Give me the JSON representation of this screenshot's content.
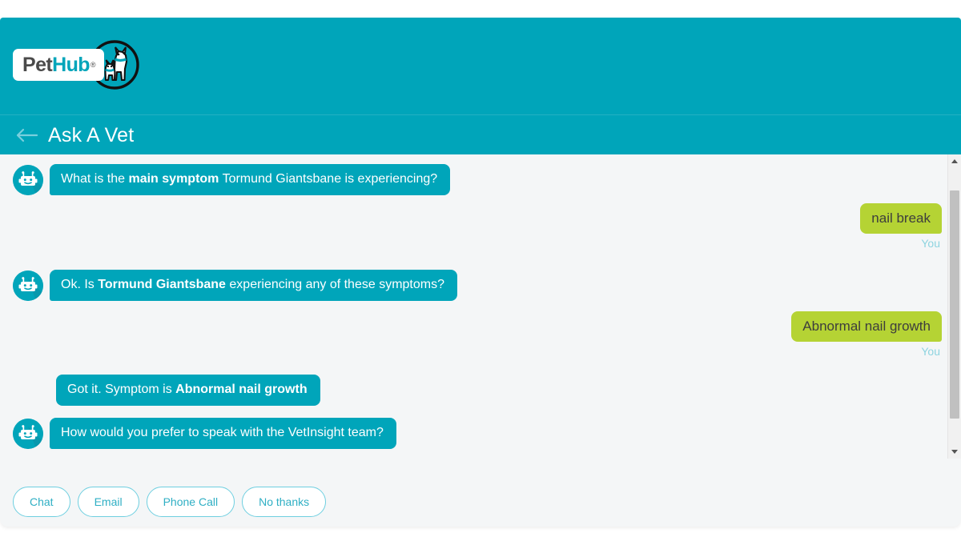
{
  "app": {
    "background_color": "#f4f6f7",
    "accent_color": "#00a5ba",
    "user_bubble_color": "#b5d334"
  },
  "header": {
    "brand": {
      "name_part1": "Pet",
      "name_part2": "Hub",
      "registered_mark": "®",
      "logo_icon": "dog-cat-circle-logo"
    },
    "back_icon": "back-arrow-icon",
    "title": "Ask A Vet"
  },
  "conversation": {
    "messages": [
      {
        "id": "m1",
        "sender": "bot",
        "avatar_icon": "robot-avatar-icon",
        "show_avatar": true,
        "text_before": "What is the ",
        "text_bold": "main symptom",
        "text_after": " Tormund Giantsbane is experiencing?"
      },
      {
        "id": "m2",
        "sender": "user",
        "text": "nail break",
        "label": "You"
      },
      {
        "id": "m3",
        "sender": "bot",
        "avatar_icon": "robot-avatar-icon",
        "show_avatar": true,
        "text_before": "Ok. Is ",
        "text_bold": "Tormund Giantsbane",
        "text_after": " experiencing any of these symptoms?"
      },
      {
        "id": "m4",
        "sender": "user",
        "text": "Abnormal nail growth",
        "label": "You"
      },
      {
        "id": "m5",
        "sender": "bot",
        "show_avatar": false,
        "text_before": "Got it. Symptom is ",
        "text_bold": "Abnormal nail growth",
        "text_after": ""
      },
      {
        "id": "m6",
        "sender": "bot",
        "avatar_icon": "robot-avatar-icon",
        "show_avatar": true,
        "text_before": "How would you prefer to speak with the VetInsight team?",
        "text_bold": "",
        "text_after": ""
      }
    ]
  },
  "quick_replies": [
    {
      "label": "Chat"
    },
    {
      "label": "Email"
    },
    {
      "label": "Phone Call"
    },
    {
      "label": "No thanks"
    }
  ],
  "scrollbar": {
    "up_icon": "scroll-up-arrow-icon",
    "down_icon": "scroll-down-arrow-icon"
  }
}
